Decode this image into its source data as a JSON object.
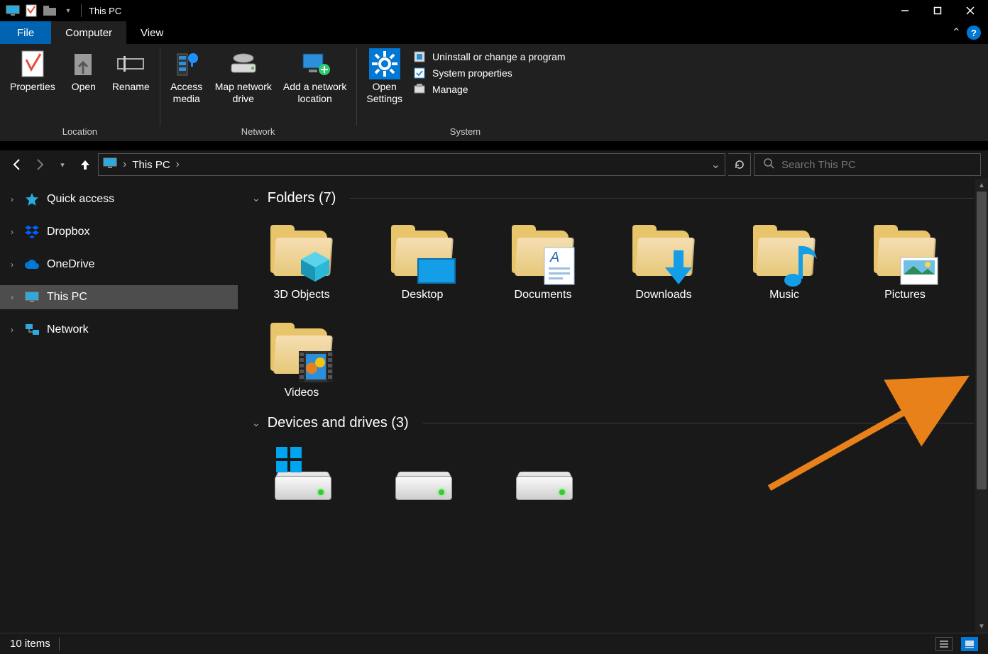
{
  "window": {
    "title": "This PC"
  },
  "tabs": {
    "file": "File",
    "computer": "Computer",
    "view": "View"
  },
  "ribbon": {
    "groups": {
      "location": {
        "name": "Location",
        "properties": "Properties",
        "open": "Open",
        "rename": "Rename"
      },
      "network": {
        "name": "Network",
        "access_media": "Access\nmedia",
        "map_drive": "Map network\ndrive",
        "add_location": "Add a network\nlocation"
      },
      "system": {
        "name": "System",
        "open_settings": "Open\nSettings",
        "uninstall": "Uninstall or change a program",
        "sys_props": "System properties",
        "manage": "Manage"
      }
    }
  },
  "address": {
    "location": "This PC"
  },
  "search": {
    "placeholder": "Search This PC"
  },
  "tree": {
    "quick_access": "Quick access",
    "dropbox": "Dropbox",
    "onedrive": "OneDrive",
    "this_pc": "This PC",
    "network": "Network"
  },
  "content": {
    "folders_header": "Folders (7)",
    "drives_header": "Devices and drives (3)",
    "folders": [
      "3D Objects",
      "Desktop",
      "Documents",
      "Downloads",
      "Music",
      "Pictures",
      "Videos"
    ]
  },
  "status": {
    "count": "10 items"
  }
}
